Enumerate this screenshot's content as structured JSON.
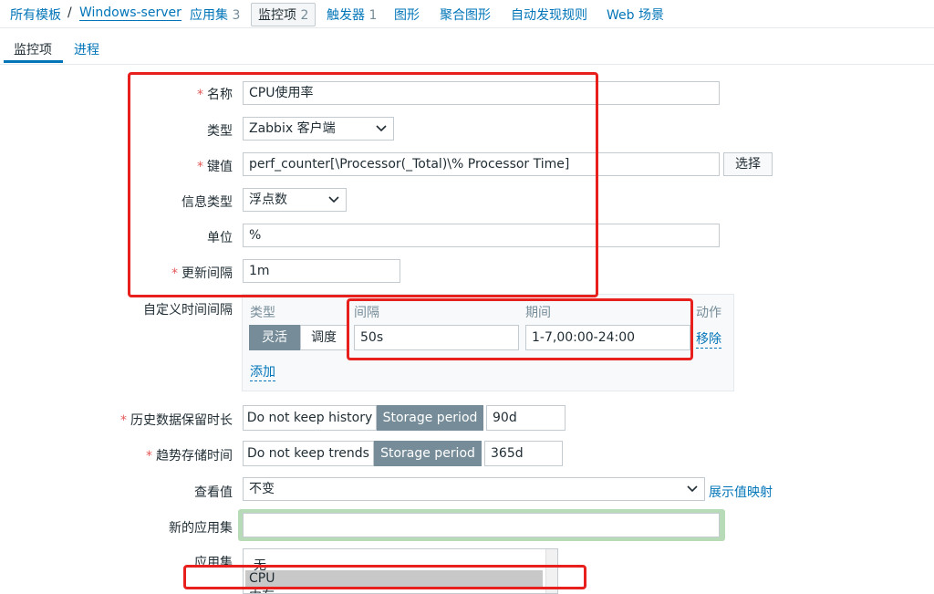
{
  "breadcrumb": {
    "all_templates": "所有模板",
    "separator": "/",
    "host": "Windows-server",
    "app_sets": "应用集",
    "app_sets_count": "3",
    "items": "监控项",
    "items_count": "2",
    "triggers": "触发器",
    "triggers_count": "1",
    "graphs": "图形",
    "screens": "聚合图形",
    "discovery": "自动发现规则",
    "web": "Web 场景"
  },
  "subtabs": {
    "item": "监控项",
    "process": "进程"
  },
  "form": {
    "name_label": "名称",
    "name_value": "CPU使用率",
    "type_label": "类型",
    "type_value": "Zabbix 客户端",
    "key_label": "键值",
    "key_value": "perf_counter[\\Processor(_Total)\\% Processor Time]",
    "key_select_button": "选择",
    "info_type_label": "信息类型",
    "info_type_value": "浮点数",
    "units_label": "单位",
    "units_value": "%",
    "update_interval_label": "更新间隔",
    "update_interval_value": "1m",
    "custom_intervals_label": "自定义时间间隔",
    "custom_intervals": {
      "col_type": "类型",
      "col_interval": "间隔",
      "col_period": "期间",
      "col_action": "动作",
      "flexible": "灵活",
      "scheduling": "调度",
      "interval_value": "50s",
      "period_value": "1-7,00:00-24:00",
      "remove": "移除",
      "add": "添加"
    },
    "history_label": "历史数据保留时长",
    "history_no_keep": "Do not keep history",
    "history_storage": "Storage period",
    "history_value": "90d",
    "trends_label": "趋势存储时间",
    "trends_no_keep": "Do not keep trends",
    "trends_storage": "Storage period",
    "trends_value": "365d",
    "show_value_label": "查看值",
    "show_value_value": "不变",
    "show_value_mapping_link": "展示值映射",
    "new_app_label": "新的应用集",
    "new_app_value": "",
    "applications_label": "应用集",
    "applications_options": [
      "-无-",
      "CPU",
      "内存"
    ]
  },
  "colors": {
    "link": "#0275b8",
    "toggle_active": "#768d99",
    "highlight_red": "#e8201d",
    "required_star": "#e45959",
    "focus_green": "#b7dbb7"
  }
}
